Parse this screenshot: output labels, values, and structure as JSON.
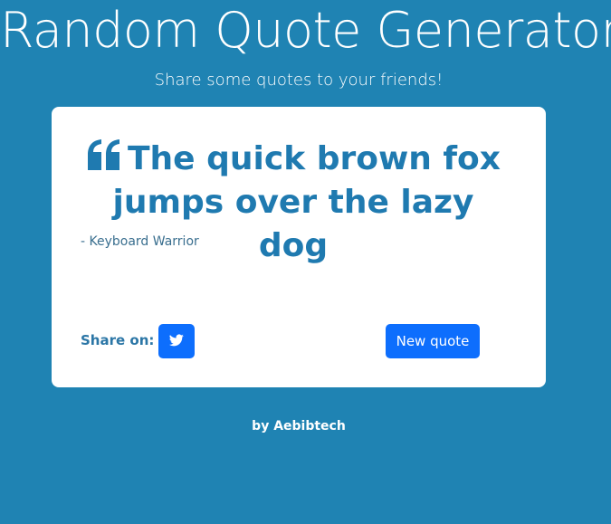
{
  "header": {
    "title": "Random Quote Generator",
    "subtitle": "Share some quotes to your friends!"
  },
  "quote": {
    "icon": "quote-left-icon",
    "text": "The quick brown fox jumps over the lazy dog",
    "author": "- Keyboard Warrior"
  },
  "share": {
    "label": "Share on:",
    "twitter_icon": "twitter-icon"
  },
  "actions": {
    "new_quote_label": "New quote"
  },
  "footer": {
    "credit": "by Aebibtech"
  },
  "colors": {
    "background": "#1f83b3",
    "card": "#ffffff",
    "quote_text": "#1f7ab0",
    "button": "#0d6efd"
  }
}
